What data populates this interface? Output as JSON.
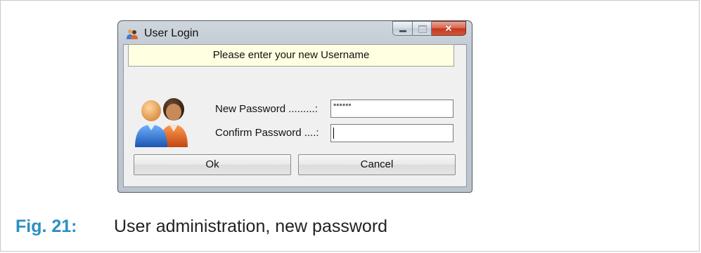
{
  "window": {
    "title": "User Login",
    "app_icon": "users-icon",
    "caption_buttons": {
      "minimize": "minimize-icon",
      "maximize": "maximize-icon",
      "close": "close-icon"
    }
  },
  "dialog": {
    "banner": "Please enter your new Username",
    "avatar_icon": "users-avatar-icon",
    "new_password_label": "New Password .........:",
    "new_password_value": "******",
    "confirm_password_label": "Confirm Password ....:",
    "confirm_password_value": "",
    "ok_label": "Ok",
    "cancel_label": "Cancel"
  },
  "caption": {
    "figure_number": "Fig. 21:",
    "text": "User administration, new password"
  },
  "colors": {
    "caption_accent": "#2b8fc4",
    "banner_bg": "#ffffe1",
    "close_button": "#c3371b"
  }
}
